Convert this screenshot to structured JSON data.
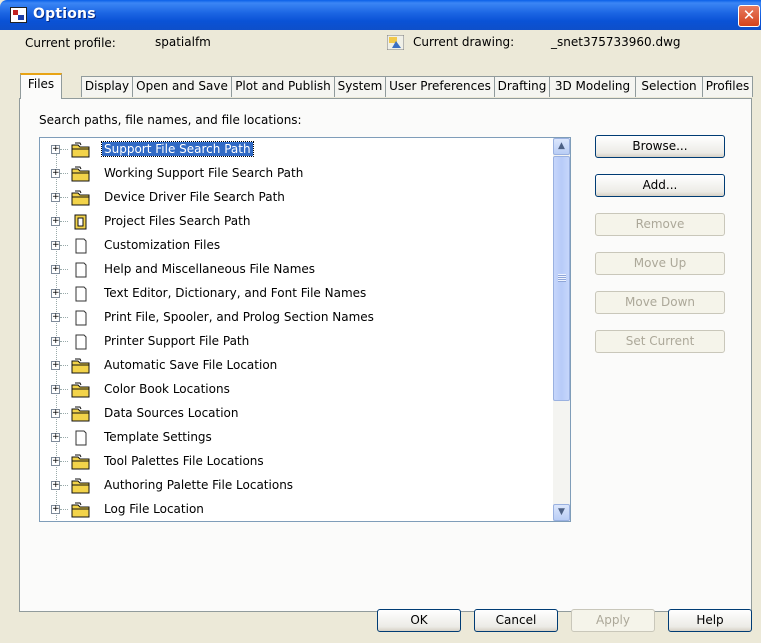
{
  "window": {
    "title": "Options",
    "close_glyph": "✕"
  },
  "profile": {
    "current_profile_label": "Current profile:",
    "current_profile_value": "spatialfm",
    "current_drawing_label": "Current drawing:",
    "current_drawing_value": "_snet375733960.dwg"
  },
  "tabs": [
    {
      "label": "Files",
      "active": true
    },
    {
      "label": "Display"
    },
    {
      "label": "Open and Save"
    },
    {
      "label": "Plot and Publish"
    },
    {
      "label": "System"
    },
    {
      "label": "User Preferences"
    },
    {
      "label": "Drafting"
    },
    {
      "label": "3D Modeling"
    },
    {
      "label": "Selection"
    },
    {
      "label": "Profiles"
    }
  ],
  "files_panel": {
    "heading": "Search paths, file names, and file locations:",
    "tree_items": [
      {
        "label": "Support File Search Path",
        "icon": "folder-icon",
        "selected": true
      },
      {
        "label": "Working Support File Search Path",
        "icon": "folder-icon"
      },
      {
        "label": "Device Driver File Search Path",
        "icon": "folder-icon"
      },
      {
        "label": "Project Files Search Path",
        "icon": "project-icon"
      },
      {
        "label": "Customization Files",
        "icon": "document-icon"
      },
      {
        "label": "Help and Miscellaneous File Names",
        "icon": "document-icon"
      },
      {
        "label": "Text Editor, Dictionary, and Font File Names",
        "icon": "document-icon"
      },
      {
        "label": "Print File, Spooler, and Prolog Section Names",
        "icon": "document-icon"
      },
      {
        "label": "Printer Support File Path",
        "icon": "document-icon"
      },
      {
        "label": "Automatic Save File Location",
        "icon": "folder-icon"
      },
      {
        "label": "Color Book Locations",
        "icon": "folder-icon"
      },
      {
        "label": "Data Sources Location",
        "icon": "folder-icon"
      },
      {
        "label": "Template Settings",
        "icon": "document-icon"
      },
      {
        "label": "Tool Palettes File Locations",
        "icon": "folder-icon"
      },
      {
        "label": "Authoring Palette File Locations",
        "icon": "folder-icon"
      },
      {
        "label": "Log File Location",
        "icon": "folder-icon"
      }
    ],
    "buttons": {
      "browse": "Browse...",
      "add": "Add...",
      "remove": "Remove",
      "move_up": "Move Up",
      "move_down": "Move Down",
      "set_current": "Set Current"
    }
  },
  "footer": {
    "ok": "OK",
    "cancel": "Cancel",
    "apply": "Apply",
    "help": "Help"
  },
  "colors": {
    "title_bar": "#0a52d6",
    "selection": "#316ac5",
    "folder": "#f2d34a",
    "face": "#ece9d8"
  }
}
